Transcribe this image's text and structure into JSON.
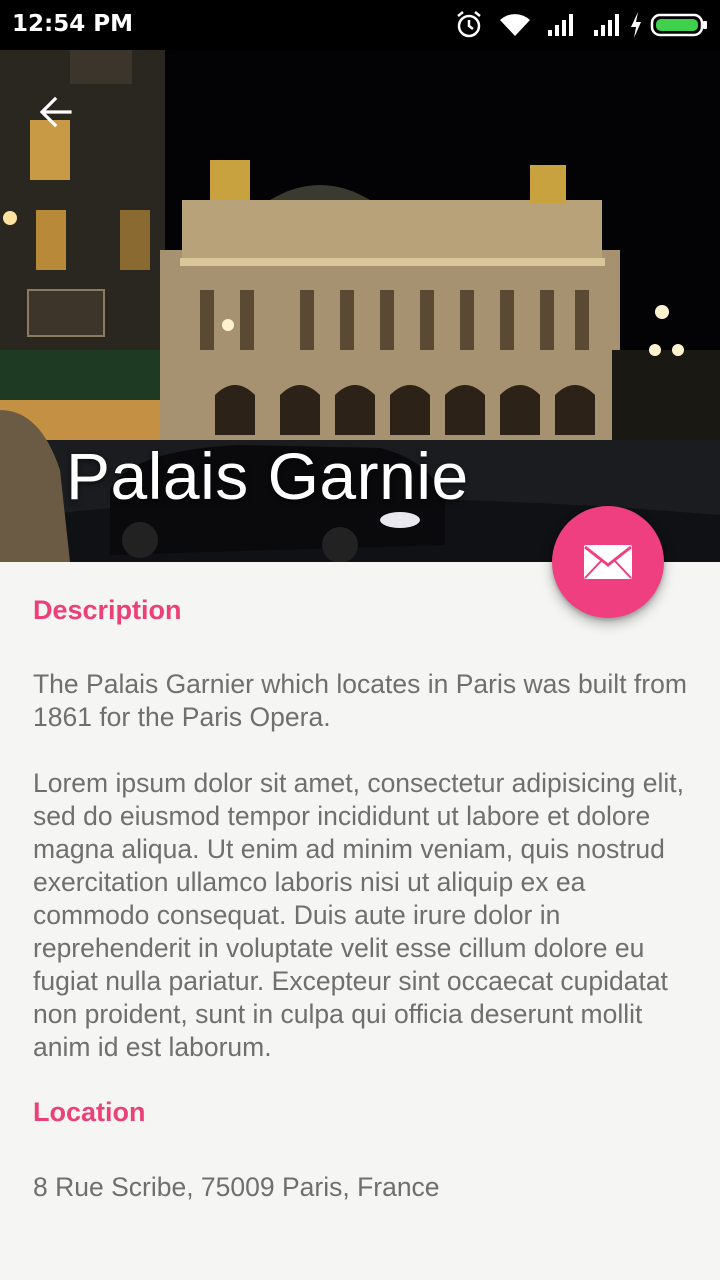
{
  "status_bar": {
    "time": "12:54 PM"
  },
  "header": {
    "title": "Palais Garnie",
    "back_icon": "arrow-back-icon"
  },
  "fab": {
    "icon": "mail-icon",
    "color": "#f03f80"
  },
  "sections": {
    "description": {
      "title": "Description",
      "paragraph1": "The Palais Garnier which locates in Paris was built from 1861 for the Paris Opera.",
      "paragraph2": "Lorem ipsum dolor sit amet, consectetur adipisicing elit, sed do eiusmod tempor incididunt ut labore et dolore magna aliqua. Ut enim ad minim veniam, quis nostrud exercitation ullamco laboris nisi ut aliquip ex ea commodo consequat. Duis aute irure dolor in reprehenderit in voluptate velit esse cillum dolore eu fugiat nulla pariatur. Excepteur sint occaecat cupidatat non proident, sunt in culpa qui officia deserunt mollit anim id est laborum."
    },
    "location": {
      "title": "Location",
      "address": "8 Rue Scribe, 75009 Paris, France"
    }
  },
  "colors": {
    "accent": "#ec407a",
    "body_text": "#6f6f6f",
    "background": "#f5f5f3"
  }
}
